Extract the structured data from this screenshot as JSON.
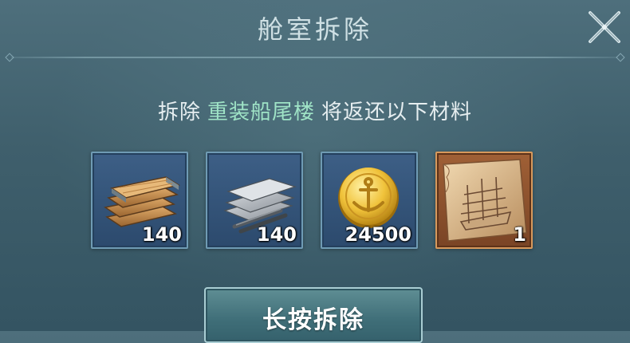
{
  "dialog": {
    "title": "舱室拆除",
    "close_icon": "close-x-icon"
  },
  "message": {
    "prefix": "拆除",
    "highlight": "重装船尾楼",
    "suffix": "将返还以下材料",
    "highlight_color": "#9fe3c6"
  },
  "materials": [
    {
      "icon": "wood-planks-icon",
      "quantity": "140",
      "rarity_color": "#3d5f86"
    },
    {
      "icon": "steel-plates-icon",
      "quantity": "140",
      "rarity_color": "#3d5f86"
    },
    {
      "icon": "gold-anchor-coin-icon",
      "quantity": "24500",
      "rarity_color": "#3d5f86"
    },
    {
      "icon": "ship-blueprint-icon",
      "quantity": "1",
      "rarity_color": "#a06036"
    }
  ],
  "action": {
    "hold_button_label": "长按拆除"
  }
}
